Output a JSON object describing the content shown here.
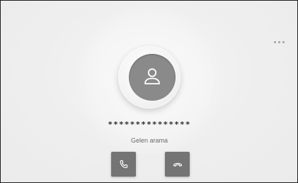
{
  "caller": {
    "number_masked": "***************",
    "status": "Gelen arama"
  },
  "icons": {
    "avatar": "person-icon",
    "more": "more-dots-icon",
    "answer": "phone-answer-icon",
    "decline": "phone-hangup-icon"
  },
  "colors": {
    "background": "#eeeeee",
    "avatar_fill": "#8a8a8a",
    "button_fill": "#747474",
    "icon_stroke": "#ffffff",
    "number_text": "#2f2f2f",
    "status_text": "#6b6b6b"
  }
}
